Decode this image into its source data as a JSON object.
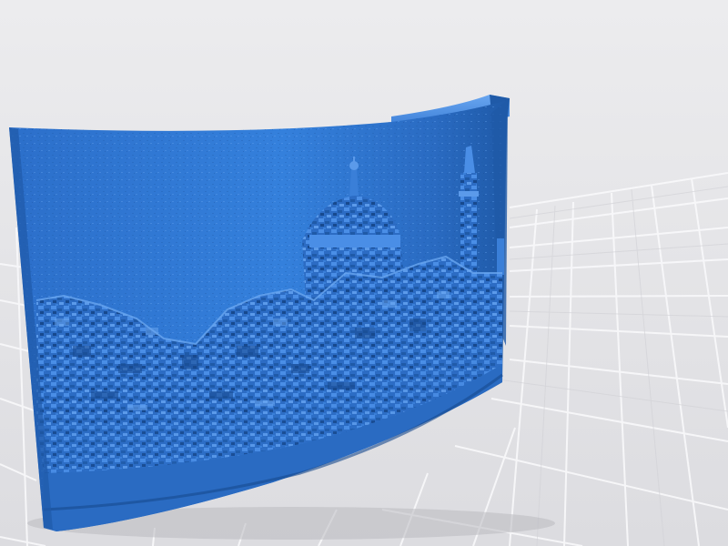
{
  "scene": {
    "subject": "3d-printed-lithophane-render",
    "colors": {
      "background": "#e4e4e6",
      "grid_line": "#f7f7f8",
      "grid_line_dark": "#d2d2d6",
      "model_base": "#2f74d0",
      "model_light": "#4a8ee6",
      "model_dark": "#1f5aa8",
      "model_deep": "#17498e",
      "model_highlight": "#69a6f0"
    }
  }
}
